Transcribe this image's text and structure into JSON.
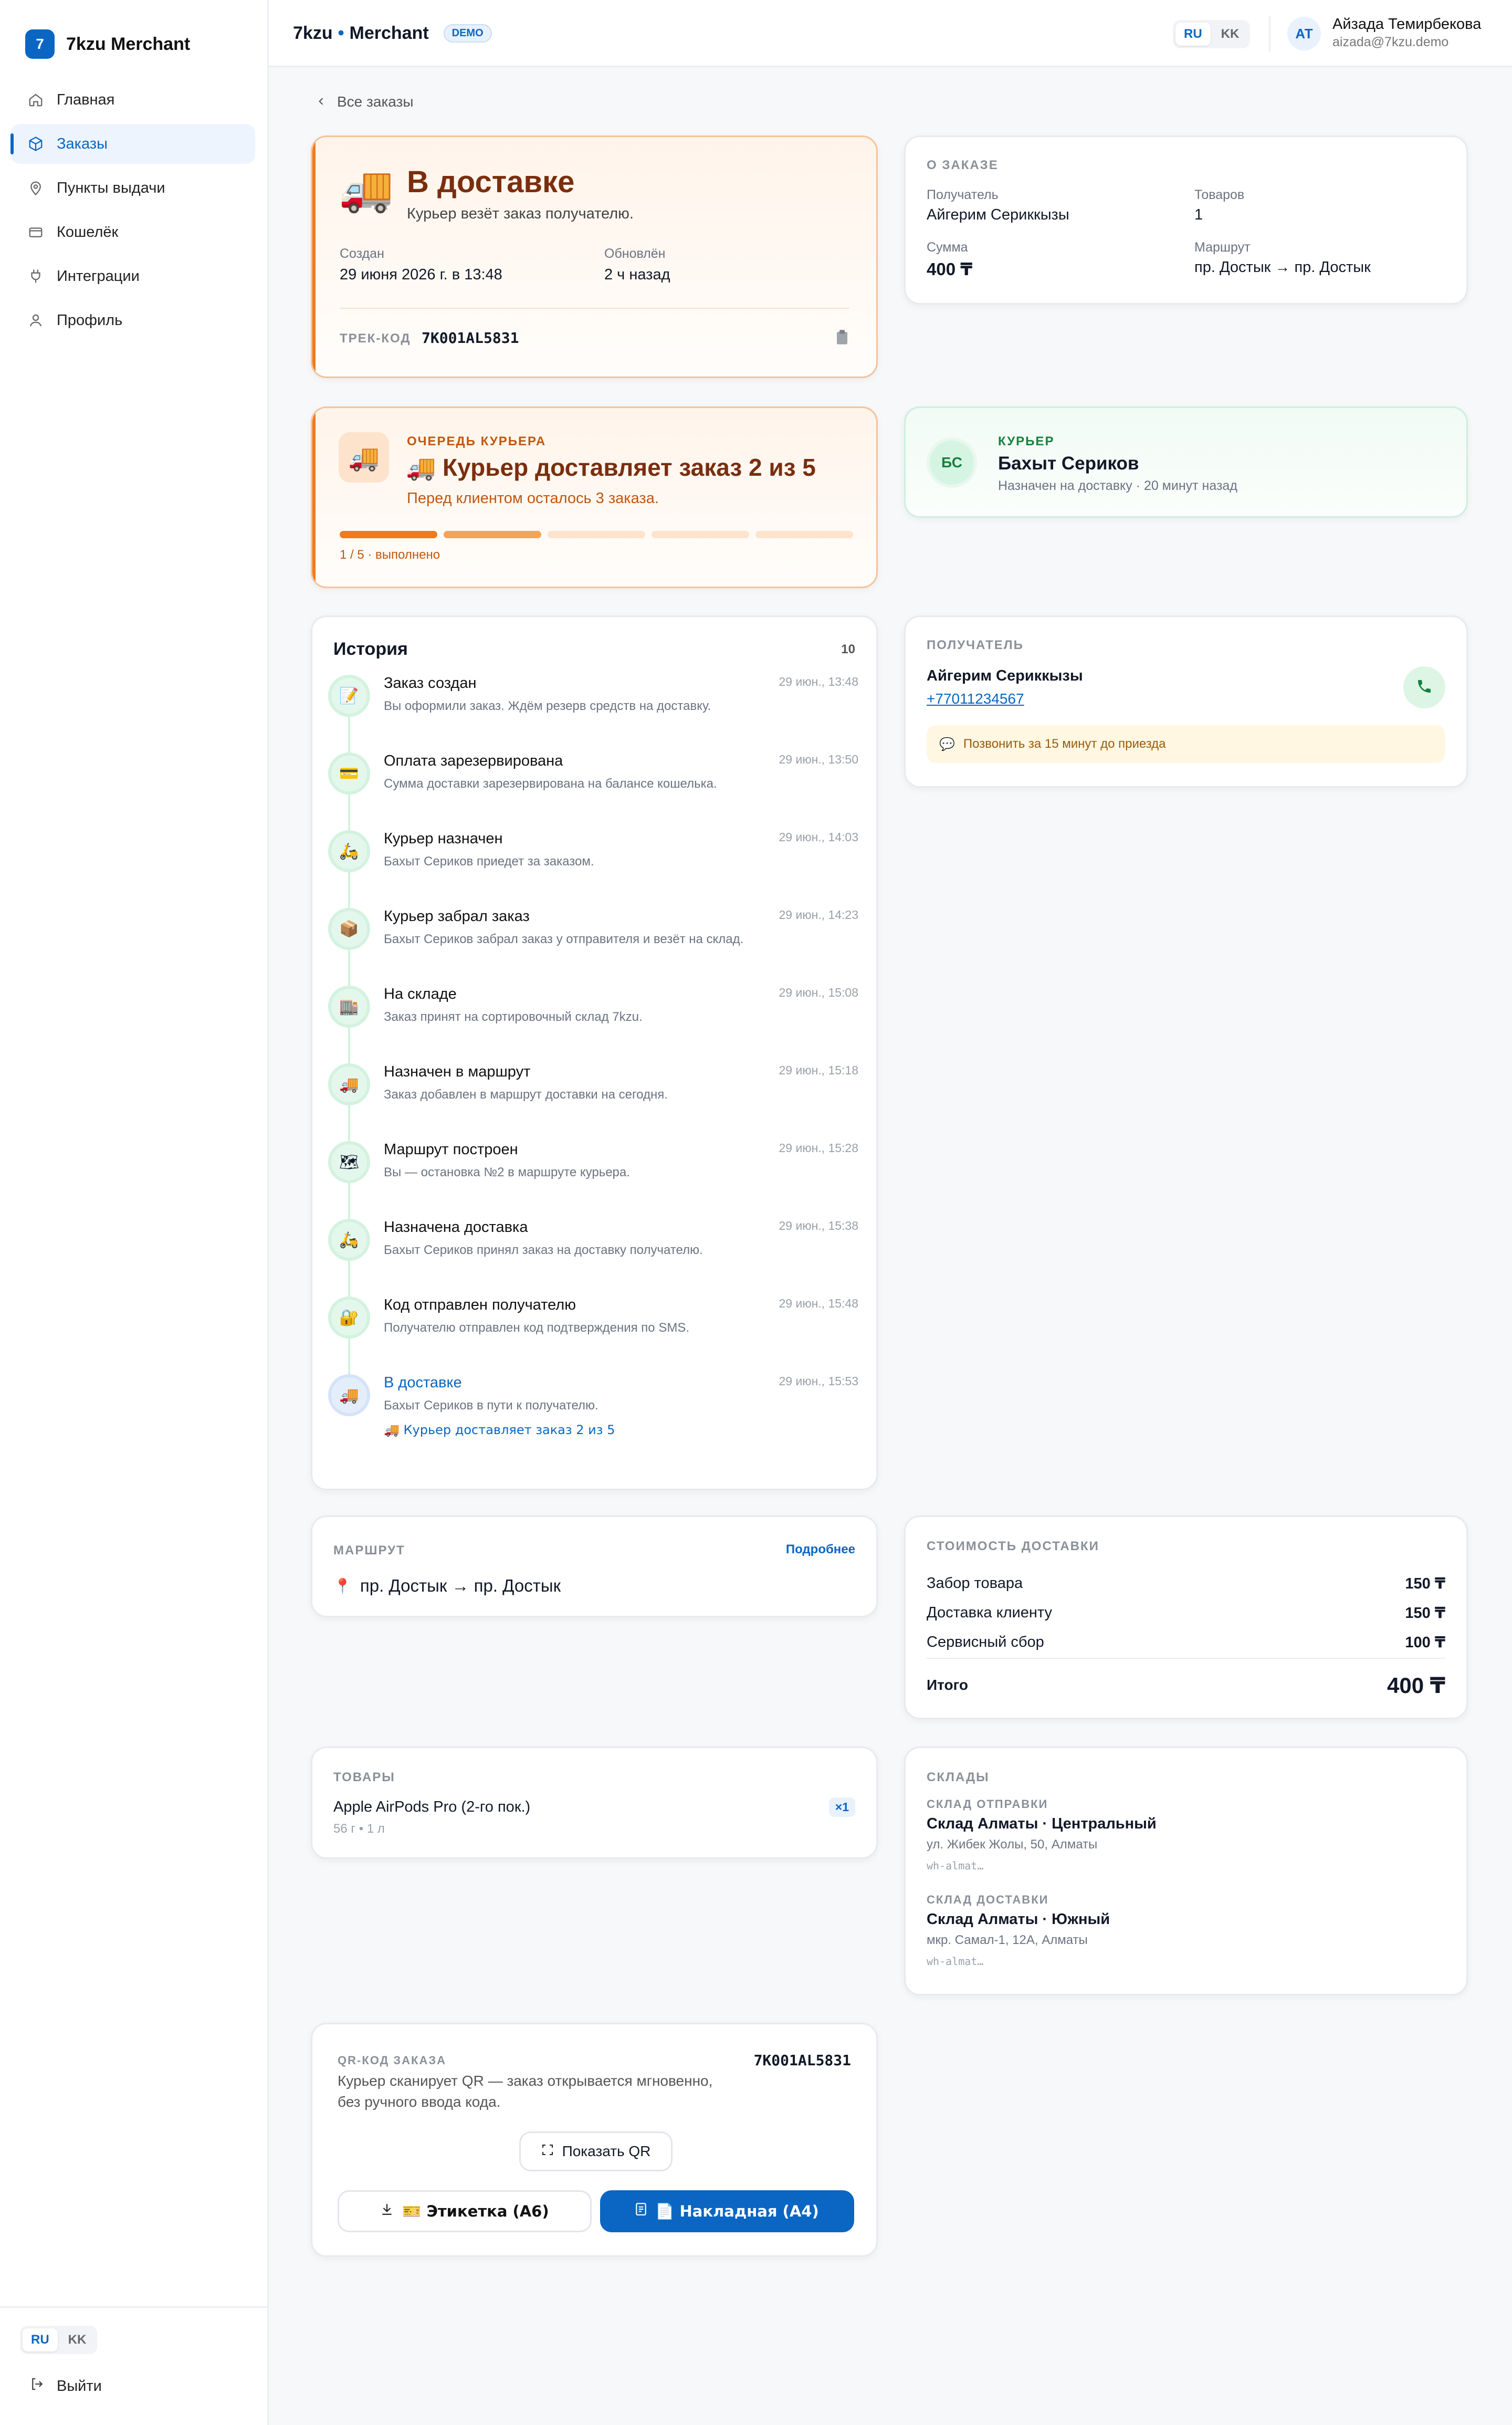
{
  "brand": {
    "logo_letter": "7",
    "name": "7kzu Merchant"
  },
  "nav": [
    {
      "label": "Главная",
      "icon": "home-icon",
      "active": false
    },
    {
      "label": "Заказы",
      "icon": "box-icon",
      "active": true
    },
    {
      "label": "Пункты выдачи",
      "icon": "map-pin-icon",
      "active": false
    },
    {
      "label": "Кошелёк",
      "icon": "wallet-icon",
      "active": false
    },
    {
      "label": "Интеграции",
      "icon": "plug-icon",
      "active": false
    },
    {
      "label": "Профиль",
      "icon": "user-icon",
      "active": false
    }
  ],
  "lang": {
    "ru": "RU",
    "kk": "KK",
    "selected": "RU"
  },
  "logout": "Выйти",
  "header": {
    "brand": "7kzu",
    "dot": "•",
    "section": "Merchant",
    "badge": "DEMO",
    "user_initials": "АТ",
    "user_name": "Айзада Темирбекова",
    "user_email": "aizada@7kzu.demo"
  },
  "back_link": "Все заказы",
  "status": {
    "emoji": "🚚",
    "title": "В доставке",
    "subtitle": "Курьер везёт заказ получателю.",
    "created_label": "Создан",
    "created_value": "29 июня 2026 г. в 13:48",
    "updated_label": "Обновлён",
    "updated_value": "2 ч назад",
    "track_label": "ТРЕК-КОД",
    "track_code": "7K001AL5831",
    "copy_icon": "clipboard-icon"
  },
  "about": {
    "title": "О ЗАКАЗЕ",
    "recipient_label": "Получатель",
    "recipient": "Айгерим Сериккызы",
    "items_label": "Товаров",
    "items": "1",
    "sum_label": "Сумма",
    "sum": "400 ₸",
    "route_label": "Маршрут",
    "route": "пр. Достык → пр. Достык"
  },
  "queue": {
    "emoji": "🚚",
    "label": "ОЧЕРЕДЬ КУРЬЕРА",
    "title": "🚚 Курьер доставляет заказ 2 из 5",
    "subtitle": "Перед клиентом осталось 3 заказа.",
    "progress": "1 / 5 · выполнено",
    "total_stops": 5,
    "done_stops": 1,
    "current_stop": 2
  },
  "courier": {
    "initials": "БС",
    "label": "КУРЬЕР",
    "name": "Бахыт Сериков",
    "note": "Назначен на доставку · 20 минут назад"
  },
  "history": {
    "title": "История",
    "count": "10",
    "steps": [
      {
        "icon": "📝",
        "title": "Заказ создан",
        "desc": "Вы оформили заказ. Ждём резерв средств на доставку.",
        "time": "29 июн., 13:48"
      },
      {
        "icon": "💳",
        "title": "Оплата зарезервирована",
        "desc": "Сумма доставки зарезервирована на балансе кошелька.",
        "time": "29 июн., 13:50"
      },
      {
        "icon": "🛵",
        "title": "Курьер назначен",
        "desc": "Бахыт Сериков приедет за заказом.",
        "time": "29 июн., 14:03"
      },
      {
        "icon": "📦",
        "title": "Курьер забрал заказ",
        "desc": "Бахыт Сериков забрал заказ у отправителя и везёт на склад.",
        "time": "29 июн., 14:23"
      },
      {
        "icon": "🏬",
        "title": "На складе",
        "desc": "Заказ принят на сортировочный склад 7kzu.",
        "time": "29 июн., 15:08"
      },
      {
        "icon": "🚚",
        "title": "Назначен в маршрут",
        "desc": "Заказ добавлен в маршрут доставки на сегодня.",
        "time": "29 июн., 15:18"
      },
      {
        "icon": "🗺",
        "title": "Маршрут построен",
        "desc": "Вы — остановка №2 в маршруте курьера.",
        "time": "29 июн., 15:28"
      },
      {
        "icon": "🛵",
        "title": "Назначена доставка",
        "desc": "Бахыт Сериков принял заказ на доставку получателю.",
        "time": "29 июн., 15:38"
      },
      {
        "icon": "🔐",
        "title": "Код отправлен получателю",
        "desc": "Получателю отправлен код подтверждения по SMS.",
        "time": "29 июн., 15:48"
      },
      {
        "icon": "🚚",
        "title": "В доставке",
        "desc": "Бахыт Сериков в пути к получателю.",
        "time": "29 июн., 15:53",
        "extra": "🚚 Курьер доставляет заказ 2 из 5"
      }
    ]
  },
  "recipient": {
    "label": "ПОЛУЧАТЕЛЬ",
    "name": "Айгерим Сериккызы",
    "phone": "+77011234567",
    "note": "Позвонить за 15 минут до приезда"
  },
  "route": {
    "label": "МАРШРУТ",
    "more": "Подробнее",
    "value": "пр. Достык → пр. Достык"
  },
  "cost": {
    "label": "СТОИМОСТЬ ДОСТАВКИ",
    "rows": [
      {
        "name": "Забор товара",
        "value": "150 ₸"
      },
      {
        "name": "Доставка клиенту",
        "value": "150 ₸"
      },
      {
        "name": "Сервисный сбор",
        "value": "100 ₸"
      }
    ],
    "total_label": "Итого",
    "total": "400 ₸"
  },
  "goods": {
    "label": "ТОВАРЫ",
    "item": "Apple AirPods Pro (2-го пок.)",
    "meta": "56 г • 1 л",
    "qty": "×1"
  },
  "warehouses": {
    "label": "СКЛАДЫ",
    "from_label": "СКЛАД ОТПРАВКИ",
    "from_name": "Склад Алматы · Центральный",
    "from_addr": "ул. Жибек Жолы, 50, Алматы",
    "from_code": "wh-almat…",
    "to_label": "СКЛАД ДОСТАВКИ",
    "to_name": "Склад Алматы · Южный",
    "to_addr": "мкр. Самал-1, 12А, Алматы",
    "to_code": "wh-almat…"
  },
  "qr": {
    "label": "QR-КОД ЗАКАЗА",
    "code": "7K001AL5831",
    "desc_line1": "Курьер сканирует QR — заказ открывается мгновенно,",
    "desc_line2": "без ручного ввода кода.",
    "show_btn": "Показать QR",
    "label_btn": "🎫 Этикетка (А6)",
    "invoice_btn": "📄 Накладная (А4)"
  },
  "colors": {
    "accent": "#0a66c2",
    "orange": "#f07b1e",
    "status_title": "#7a2e0e",
    "green": "#16a34a"
  }
}
